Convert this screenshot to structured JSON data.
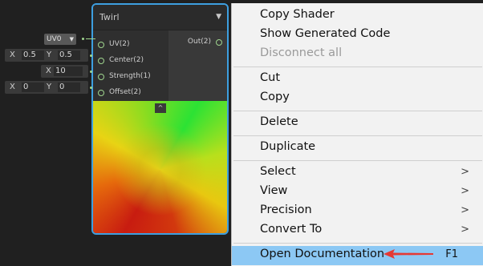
{
  "node": {
    "title": "Twirl",
    "inputs": [
      {
        "label": "UV(2)"
      },
      {
        "label": "Center(2)"
      },
      {
        "label": "Strength(1)"
      },
      {
        "label": "Offset(2)"
      }
    ],
    "output": {
      "label": "Out(2)"
    },
    "collapse_glyph": "^"
  },
  "fields": {
    "uv": {
      "value": "UV0"
    },
    "center": {
      "x_label": "X",
      "x": "0.5",
      "y_label": "Y",
      "y": "0.5"
    },
    "strength": {
      "x_label": "X",
      "x": "10"
    },
    "offset": {
      "x_label": "X",
      "x": "0",
      "y_label": "Y",
      "y": "0"
    }
  },
  "menu": {
    "items": [
      {
        "label": "Copy Shader"
      },
      {
        "label": "Show Generated Code"
      },
      {
        "label": "Disconnect all",
        "disabled": true
      },
      {
        "label": "Cut"
      },
      {
        "label": "Copy"
      },
      {
        "label": "Delete"
      },
      {
        "label": "Duplicate"
      },
      {
        "label": "Select",
        "submenu": true
      },
      {
        "label": "View",
        "submenu": true
      },
      {
        "label": "Precision",
        "submenu": true
      },
      {
        "label": "Convert To",
        "submenu": true
      },
      {
        "label": "Open Documentation",
        "shortcut": "F1",
        "highlighted": true
      }
    ],
    "submenu_glyph": ">"
  },
  "colors": {
    "accent": "#3d9fe0",
    "highlight": "#8cc8f4",
    "annotation_arrow": "#e53935",
    "port": "#9fd58e"
  }
}
